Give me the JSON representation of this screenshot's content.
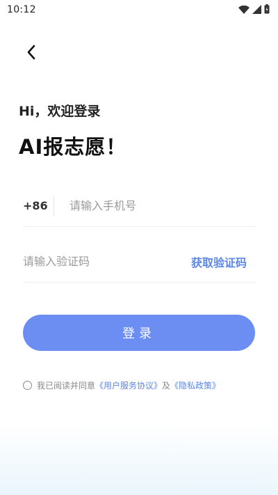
{
  "status_bar": {
    "time": "10:12",
    "icons": [
      "wifi-icon",
      "signal-icon",
      "battery-icon"
    ]
  },
  "nav": {
    "back_icon": "chevron-left-icon"
  },
  "greeting": "Hi，欢迎登录",
  "headline": "AI报志愿！",
  "phone": {
    "country_code": "+86",
    "placeholder": "请输入手机号",
    "value": ""
  },
  "code": {
    "placeholder": "请输入验证码",
    "value": "",
    "get_code_label": "获取验证码"
  },
  "login_label": "登录",
  "agreement": {
    "checked": false,
    "prefix": "我已阅读并同意",
    "terms_link": "《用户服务协议》",
    "conjunction": "及",
    "privacy_link": "《隐私政策》"
  },
  "colors": {
    "accent": "#5b86e8",
    "button": "#6c8ef3",
    "bottom_tint": "#eaf6fc"
  }
}
